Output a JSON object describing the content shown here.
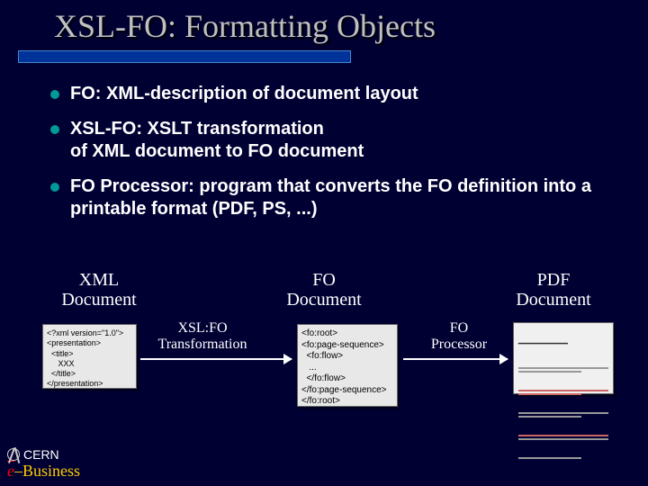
{
  "title": "XSL-FO: Formatting Objects",
  "bullets": [
    "FO: XML-description of document layout",
    "XSL-FO: XSLT transformation\nof XML document to FO document",
    "FO Processor: program that converts the FO definition into a printable format (PDF, PS, ...)"
  ],
  "diagram": {
    "labels": {
      "xml": "XML\nDocument",
      "fo": "FO\nDocument",
      "pdf": "PDF\nDocument"
    },
    "arrows": {
      "xslfo": "XSL:FO\nTransformation",
      "processor": "FO\nProcessor"
    },
    "xml_content": "<?xml version=\"1.0\">\n<presentation>\n  <title>\n     XXX\n  </title>\n</presentation>",
    "fo_content": "<fo:root>\n<fo:page-sequence>\n  <fo:flow>\n   ...\n  </fo:flow>\n</fo:page-sequence>\n</fo:root>"
  },
  "footer": {
    "cern": "CERN",
    "ebiz_e": "e",
    "ebiz_dash": "–",
    "ebiz_rest": "Business"
  }
}
